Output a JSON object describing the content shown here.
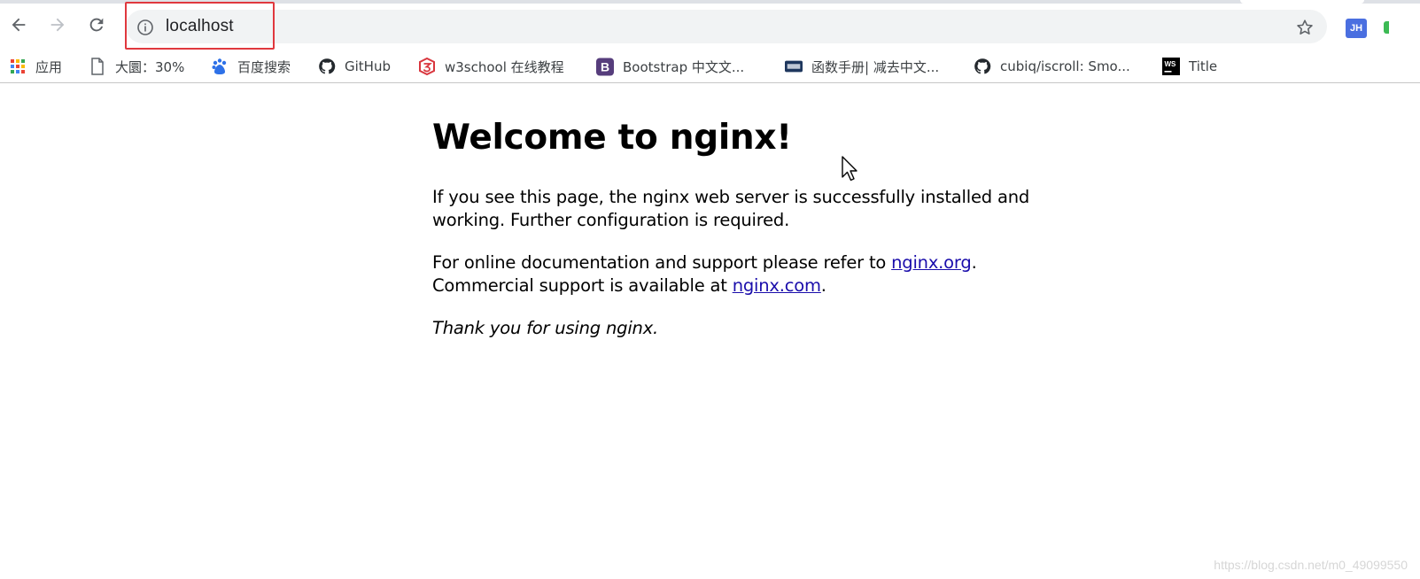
{
  "browser": {
    "url": "localhost",
    "profile_initials": "JH"
  },
  "bookmarks": [
    {
      "label": "应用",
      "icon": "apps-grid-icon"
    },
    {
      "label": "大圜：30%",
      "icon": "page-icon"
    },
    {
      "label": "百度搜索",
      "icon": "baidu-paw-icon"
    },
    {
      "label": "GitHub",
      "icon": "github-icon"
    },
    {
      "label": "w3school 在线教程",
      "icon": "w3school-icon"
    },
    {
      "label": "Bootstrap 中文文...",
      "icon": "bootstrap-icon"
    },
    {
      "label": "函数手册| 减去中文...",
      "icon": "less-icon"
    },
    {
      "label": "cubiq/iscroll: Smo...",
      "icon": "github-icon"
    },
    {
      "label": "Title",
      "icon": "webstorm-icon"
    }
  ],
  "page": {
    "heading": "Welcome to nginx!",
    "para1": "If you see this page, the nginx web server is successfully installed and working. Further configuration is required.",
    "para2_prefix": "For online documentation and support please refer to ",
    "link1": "nginx.org",
    "para2_mid": ".",
    "para2_line2": "Commercial support is available at ",
    "link2": "nginx.com",
    "para2_end": ".",
    "thanks": "Thank you for using nginx."
  },
  "watermark": "https://blog.csdn.net/m0_49099550",
  "colors": {
    "link": "#1a0dab",
    "highlight_box": "#e0383e",
    "omnibox_bg": "#f1f3f4"
  }
}
